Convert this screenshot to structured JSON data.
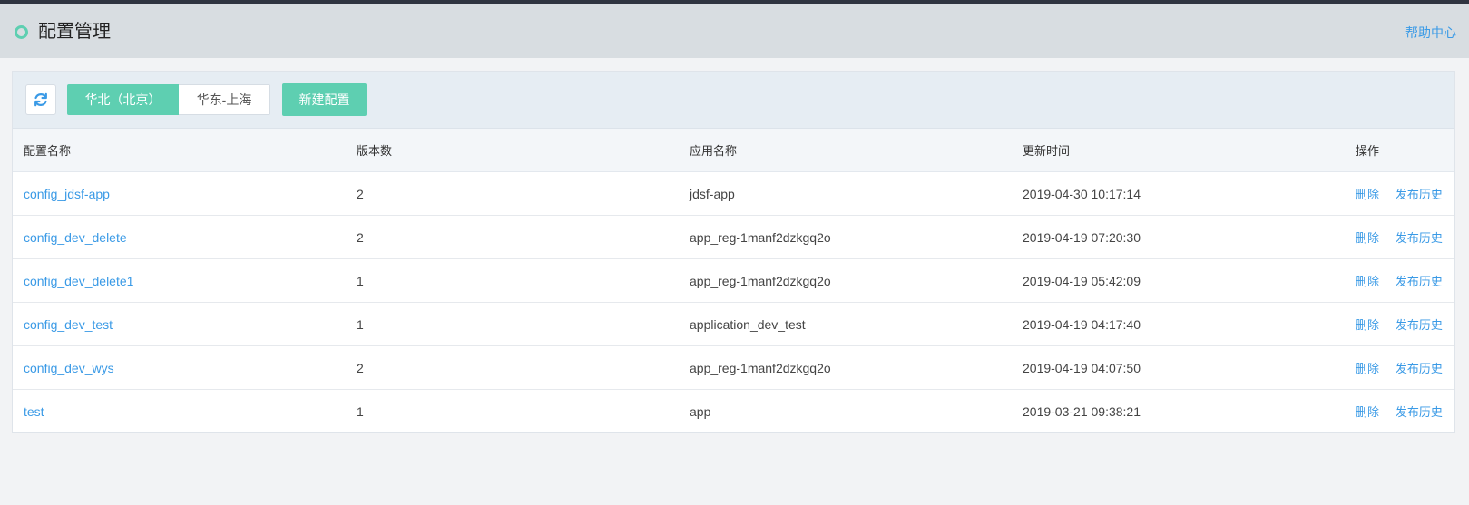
{
  "header": {
    "title": "配置管理",
    "help_label": "帮助中心"
  },
  "toolbar": {
    "regions": [
      "华北（北京）",
      "华东-上海"
    ],
    "active_region": "华北（北京）",
    "new_label": "新建配置"
  },
  "table": {
    "columns": [
      "配置名称",
      "版本数",
      "应用名称",
      "更新时间",
      "操作"
    ],
    "rows": [
      {
        "name": "config_jdsf-app",
        "versions": "2",
        "app": "jdsf-app",
        "updated": "2019-04-30 10:17:14"
      },
      {
        "name": "config_dev_delete",
        "versions": "2",
        "app": "app_reg-1manf2dzkgq2o",
        "updated": "2019-04-19 07:20:30"
      },
      {
        "name": "config_dev_delete1",
        "versions": "1",
        "app": "app_reg-1manf2dzkgq2o",
        "updated": "2019-04-19 05:42:09"
      },
      {
        "name": "config_dev_test",
        "versions": "1",
        "app": "application_dev_test",
        "updated": "2019-04-19 04:17:40"
      },
      {
        "name": "config_dev_wys",
        "versions": "2",
        "app": "app_reg-1manf2dzkgq2o",
        "updated": "2019-04-19 04:07:50"
      },
      {
        "name": "test",
        "versions": "1",
        "app": "app",
        "updated": "2019-03-21 09:38:21"
      }
    ],
    "actions": {
      "delete_label": "删除",
      "history_label": "发布历史"
    }
  },
  "colors": {
    "accent": "#5ecfb1",
    "link": "#3a9ae6",
    "header_bg": "#d8dde1"
  },
  "icons": {
    "refresh": "refresh-icon",
    "status": "circle-icon"
  }
}
